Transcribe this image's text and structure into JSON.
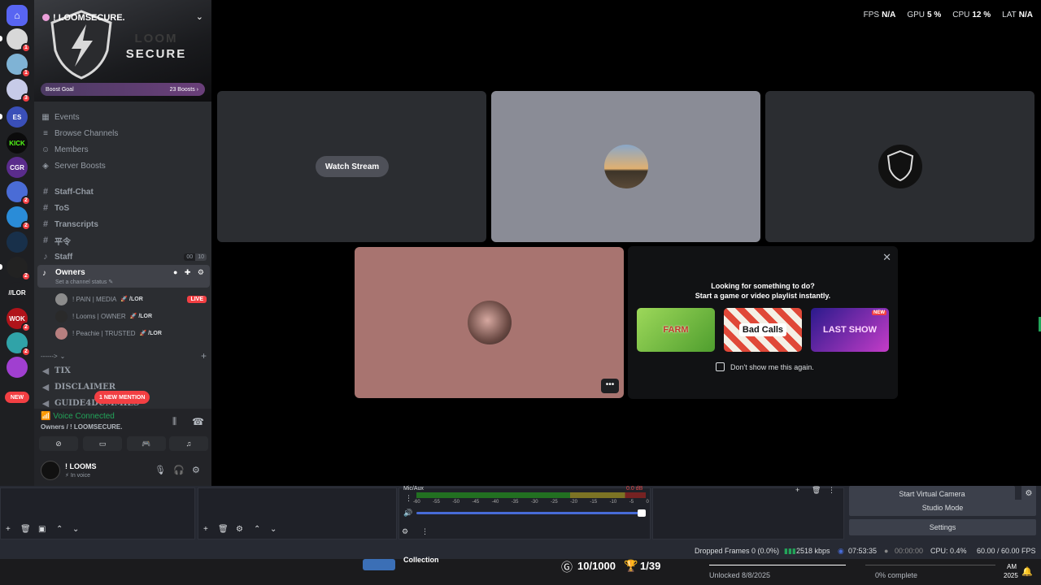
{
  "rail": {
    "servers": [
      {
        "name": "server-1",
        "badge": "1",
        "color": "#d8d8d8"
      },
      {
        "name": "server-2",
        "badge": "1",
        "color": "#7fb3d5"
      },
      {
        "name": "server-3",
        "badge": "3",
        "color": "#c7cbe8"
      },
      {
        "name": "server-es",
        "label": "ES",
        "badge": "",
        "color": "#3a4fb8"
      },
      {
        "name": "server-kick",
        "label": "KICK",
        "badge": "",
        "color": "#0b0b0b"
      },
      {
        "name": "server-cgr",
        "label": "CGR",
        "badge": "",
        "color": "#5a2c8c"
      },
      {
        "name": "server-7",
        "badge": "2",
        "color": "#4a6cd6"
      },
      {
        "name": "server-8",
        "badge": "2",
        "color": "#2a8cd8"
      },
      {
        "name": "server-9",
        "badge": "",
        "color": "#18304a"
      },
      {
        "name": "server-10",
        "badge": "2",
        "color": "#222"
      },
      {
        "name": "server-lor",
        "label": "//LOR",
        "badge": "",
        "color": "#1e1f22"
      },
      {
        "name": "server-wok",
        "label": "WOK",
        "badge": "2",
        "color": "#b0131a"
      },
      {
        "name": "server-13",
        "badge": "2",
        "color": "#30a3a8"
      },
      {
        "name": "server-14",
        "badge": "",
        "color": "#a03fd0"
      }
    ],
    "new_label": "NEW"
  },
  "sidebar": {
    "server_name": "! LOOMSECURE.",
    "logo_text_1": "LOOM",
    "logo_text_2": "SECURE",
    "boost_goal": "Boost Goal",
    "boost_count": "23 Boosts",
    "nav": [
      {
        "label": "Events",
        "icon": "calendar-icon"
      },
      {
        "label": "Browse Channels",
        "icon": "list-icon"
      },
      {
        "label": "Members",
        "icon": "members-icon"
      },
      {
        "label": "Server Boosts",
        "icon": "boost-icon"
      }
    ],
    "channels": [
      {
        "label": "Staff-Chat",
        "icon": "#"
      },
      {
        "label": "ToS",
        "icon": "#"
      },
      {
        "label": "Transcripts",
        "icon": "#"
      },
      {
        "label": "平令",
        "icon": "#"
      },
      {
        "label": "Staff",
        "icon": "🔊",
        "count_a": "00",
        "count_b": "10"
      }
    ],
    "owners": {
      "label": "Owners",
      "status": "Set a channel status",
      "users": [
        {
          "name": "! PAIN | MEDIA",
          "tag": "🚀 /LOR",
          "live": "LIVE",
          "color": "#8c8c8c"
        },
        {
          "name": "! Looms | OWNER",
          "tag": "🚀 /LOR",
          "live": "",
          "color": "#2a2a2a"
        },
        {
          "name": "! Peachie | TRUSTED",
          "tag": "🚀 /LOR",
          "live": "",
          "color": "#b77f7f"
        }
      ]
    },
    "category": "------>",
    "more_channels": [
      {
        "label": "TIX",
        "icon": "📢"
      },
      {
        "label": "DISCLAIMER",
        "icon": "📢"
      },
      {
        "label": "GUIDE4DUMMIES",
        "icon": "📢"
      }
    ],
    "mention": "1 NEW MENTION",
    "voice": {
      "connected": "Voice Connected",
      "channel": "Owners / ! LOOMSECURE."
    },
    "user": {
      "name": "! LOOMS",
      "status": "In voice"
    }
  },
  "stage": {
    "perf": [
      {
        "label": "FPS",
        "value": "N/A"
      },
      {
        "label": "GPU",
        "value": "5 %"
      },
      {
        "label": "CPU",
        "value": "12 %"
      },
      {
        "label": "LAT",
        "value": "N/A"
      }
    ],
    "watch_stream": "Watch Stream",
    "more": "•••",
    "activity": {
      "title_1": "Looking for something to do?",
      "title_2": "Start a game or video playlist instantly.",
      "games": [
        {
          "name": "FARM",
          "color": "#7cc14a"
        },
        {
          "name": "Bad Calls",
          "color": "#e04838"
        },
        {
          "name": "LAST SHOW",
          "color": "#6a2bc8",
          "badge": "NEW"
        }
      ],
      "dont_show": "Don't show me this again."
    }
  },
  "obs": {
    "mic_label": "Mic/Aux",
    "meter_ticks": [
      "-60",
      "-55",
      "-50",
      "-45",
      "-40",
      "-35",
      "-30",
      "-25",
      "-20",
      "-15",
      "-10",
      "-5",
      "0"
    ],
    "meter_db": "0.0 dB",
    "buttons": [
      "Start Virtual Camera",
      "Studio Mode",
      "Settings"
    ],
    "status": {
      "dropped": "Dropped Frames 0 (0.0%)",
      "kbps": "2518 kbps",
      "time1": "07:53:35",
      "time2": "00:00:00",
      "cpu": "CPU: 0.4%",
      "fps": "60.00 / 60.00 FPS"
    }
  },
  "taskbar": {
    "collection": "Collection",
    "score": "10/1000",
    "trophy": "1/39",
    "unlocked": "Unlocked 8/8/2025",
    "complete": "0% complete",
    "clock_1": "AM",
    "clock_2": "2025"
  }
}
